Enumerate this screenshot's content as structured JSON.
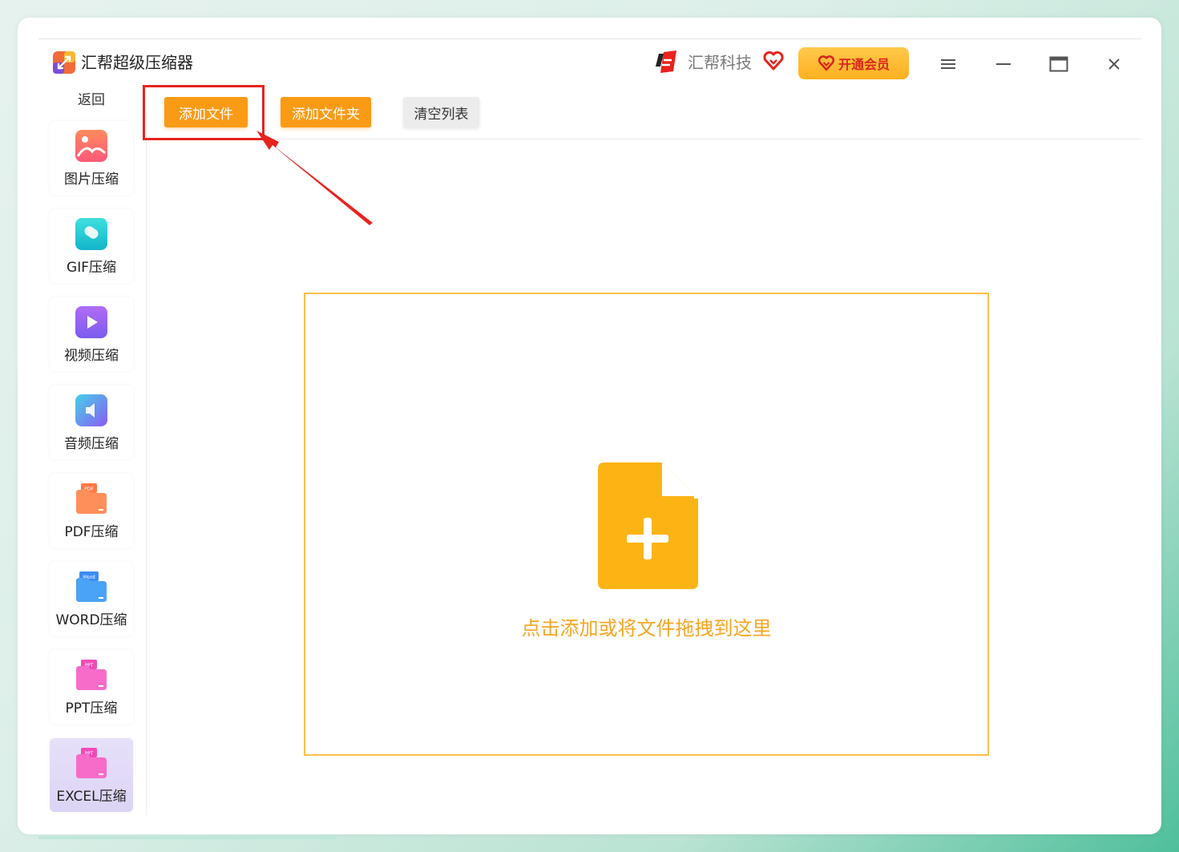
{
  "app": {
    "title": "汇帮超级压缩器",
    "brand_name": "汇帮科技",
    "vip_label": "开通会员",
    "back_label": "返回"
  },
  "sidebar": {
    "items": [
      {
        "label": "图片压缩",
        "icon": "image-icon"
      },
      {
        "label": "GIF压缩",
        "icon": "gif-icon"
      },
      {
        "label": "视频压缩",
        "icon": "video-icon"
      },
      {
        "label": "音频压缩",
        "icon": "audio-icon"
      },
      {
        "label": "PDF压缩",
        "icon": "pdf-icon"
      },
      {
        "label": "WORD压缩",
        "icon": "word-icon"
      },
      {
        "label": "PPT压缩",
        "icon": "ppt-icon"
      },
      {
        "label": "EXCEL压缩",
        "icon": "excel-icon",
        "active": true
      }
    ]
  },
  "toolbar": {
    "add_file": "添加文件",
    "add_folder": "添加文件夹",
    "clear_list": "清空列表"
  },
  "drop_zone": {
    "hint": "点击添加或将文件拖拽到这里"
  },
  "colors": {
    "accent_orange": "#fb9a15",
    "drop_border": "#fbc049",
    "annotation_red": "#e8231e"
  }
}
